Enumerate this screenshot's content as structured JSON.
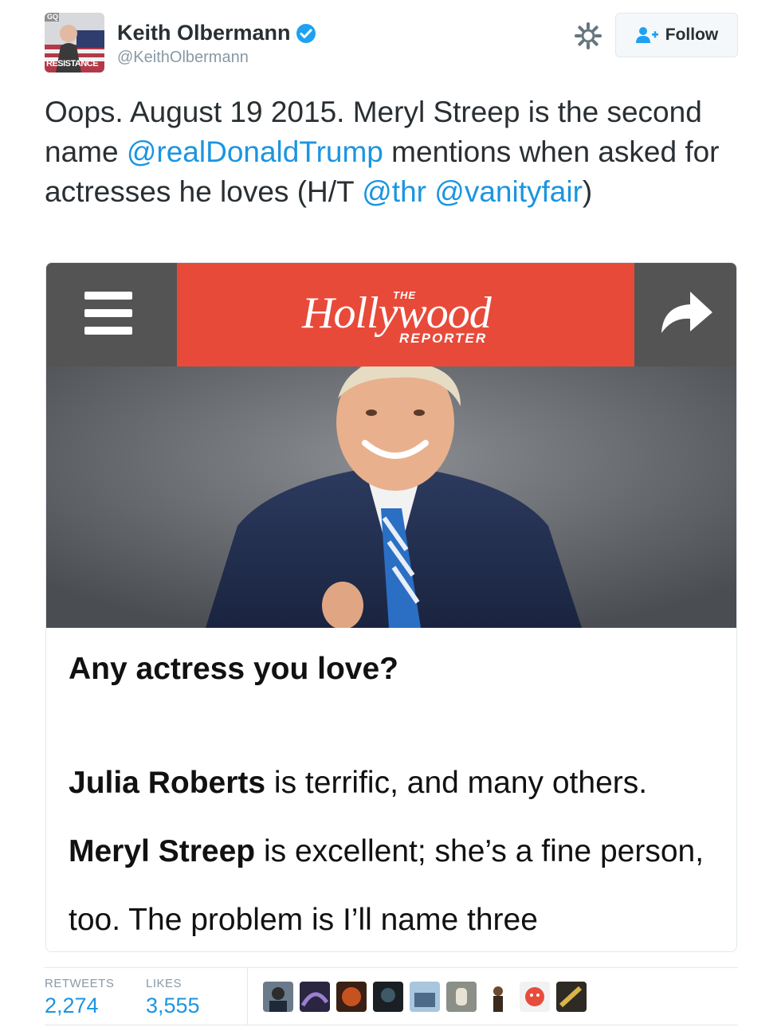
{
  "user": {
    "display_name": "Keith Olbermann",
    "handle": "@KeithOlbermann",
    "avatar_texts": {
      "badge": "GQ",
      "caption": "RESISTANCE"
    },
    "verified": true
  },
  "actions": {
    "follow_label": "Follow",
    "settings_icon": "gear-icon"
  },
  "tweet": {
    "text_1": "Oops. August 19 2015. Meryl Streep is the second name ",
    "mention_1": "@realDonaldTrump",
    "text_2": " mentions when asked for actresses he loves (H/T ",
    "mention_2": "@thr",
    "text_3": " ",
    "mention_3": "@vanityfair",
    "text_4": ")"
  },
  "card": {
    "logo_the": "THE",
    "logo_main": "Hollywood",
    "logo_sub": "REPORTER",
    "question": "Any actress you love?",
    "bold_1": "Julia Roberts",
    "text_1": " is terrific, and many others.",
    "bold_2": "Meryl Streep",
    "text_2": " is excellent; she’s a fine person, too. The problem is I’ll name three"
  },
  "stats": {
    "retweets_label": "RETWEETS",
    "retweets_value": "2,274",
    "likes_label": "LIKES",
    "likes_value": "3,555"
  },
  "colors": {
    "link": "#1b95e0",
    "thr_red": "#e84a3a",
    "thr_bar": "#545454",
    "muted": "#8899a6"
  }
}
